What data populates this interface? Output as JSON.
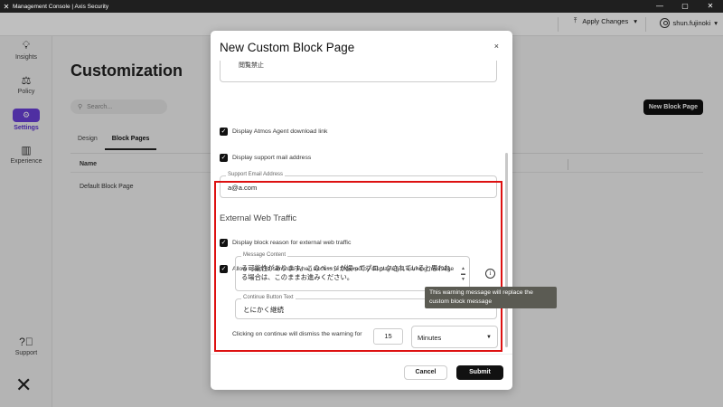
{
  "window": {
    "title": "Management Console | Axis Security",
    "controls": [
      "—",
      "▢",
      "✕"
    ]
  },
  "header": {
    "apply_changes": "Apply Changes",
    "username": "shun.fujinoki"
  },
  "sidebar": {
    "items": [
      {
        "label": "Insights",
        "icon": "lightbulb-icon"
      },
      {
        "label": "Policy",
        "icon": "policy-icon"
      },
      {
        "label": "Settings",
        "icon": "gear-icon",
        "active": true
      },
      {
        "label": "Experience",
        "icon": "bar-chart-icon"
      }
    ],
    "support": "Support"
  },
  "page": {
    "title": "Customization",
    "search_placeholder": "Search...",
    "new_button": "New Block Page",
    "tabs": [
      "Design",
      "Block Pages"
    ],
    "active_tab": "Block Pages",
    "table_header": "Name",
    "rows": [
      "Default Block Page"
    ]
  },
  "modal": {
    "title": "New Custom Block Page",
    "close": "×",
    "top_text": "閲覧禁止",
    "checkbox_atmos": "Display Atmos Agent download link",
    "checkbox_support_mail": "Display support mail address",
    "support_email_label": "Support Email Address",
    "support_email_value": "a@a.com",
    "section_title": "External Web Traffic",
    "checkbox_block_reason": "Display block reason for external web traffic",
    "checkbox_allow_continue": "Allow users to continue when access is blocked by displaying a warning message",
    "message_content_label": "Message Content",
    "message_content_value": "る可能性があります。このページが誤ってブロックされていると思われる場合は、このままお進みください。",
    "continue_button_label": "Continue Button Text",
    "continue_button_value": "とにかく継続",
    "dismiss_label": "Clicking on continue will dismiss the warning for",
    "dismiss_value": "15",
    "dismiss_unit": "Minutes",
    "cancel": "Cancel",
    "submit": "Submit"
  },
  "tooltip": {
    "text": "This warning message will replace the custom block message"
  },
  "colors": {
    "accent": "#6a3fd8",
    "highlight": "#dd1111",
    "titlebar": "#1f1f1f"
  }
}
